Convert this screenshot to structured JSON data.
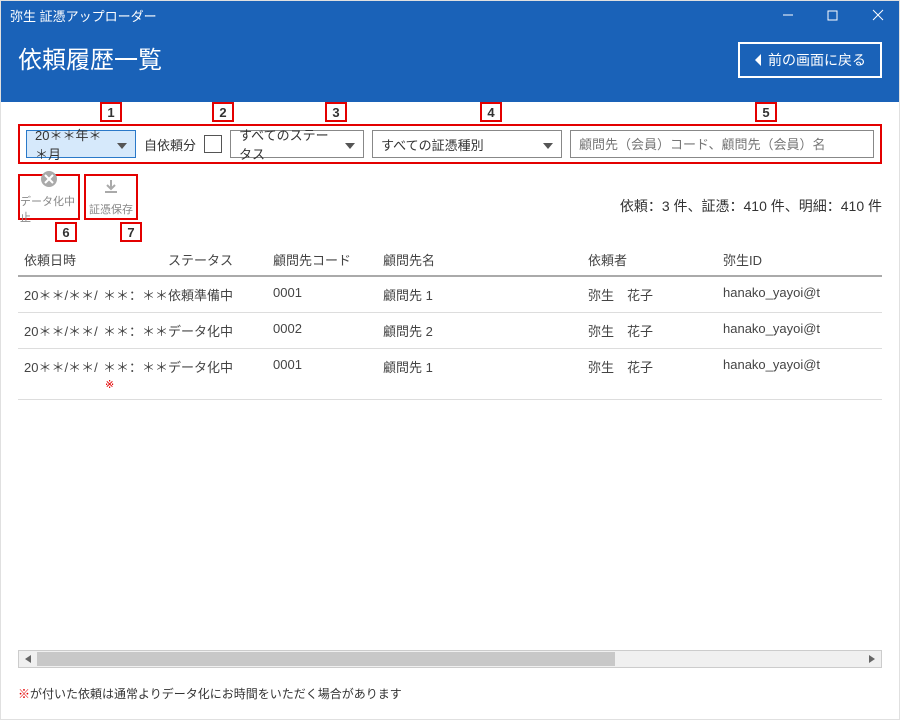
{
  "window": {
    "title": "弥生 証憑アップローダー"
  },
  "header": {
    "title": "依頼履歴一覧",
    "back_label": "前の画面に戻る"
  },
  "callouts": [
    "1",
    "2",
    "3",
    "4",
    "5",
    "6",
    "7"
  ],
  "filters": {
    "date": "20＊＊年＊＊月",
    "self_label": "自依頼分",
    "status": "すべてのステータス",
    "category": "すべての証憑種別",
    "search_placeholder": "顧問先（会員）コード、顧問先（会員）名"
  },
  "tools": {
    "cancel": "データ化中止",
    "save": "証憑保存"
  },
  "counts_text": "依頼：3 件、証憑：410 件、明細：410 件",
  "columns": {
    "datetime": "依頼日時",
    "status": "ステータス",
    "code": "顧問先コード",
    "client": "顧問先名",
    "requester": "依頼者",
    "yayoi_id": "弥生ID"
  },
  "rows": [
    {
      "date": "20＊＊/＊＊/",
      "time": "＊＊：＊＊",
      "mark": "",
      "status": "依頼準備中",
      "code": "0001",
      "client": "顧問先 1",
      "requester": "弥生　花子",
      "yayoi_id": "hanako_yayoi@t"
    },
    {
      "date": "20＊＊/＊＊/",
      "time": "＊＊：＊＊",
      "mark": "",
      "status": "データ化中",
      "code": "0002",
      "client": "顧問先 2",
      "requester": "弥生　花子",
      "yayoi_id": "hanako_yayoi@t"
    },
    {
      "date": "20＊＊/＊＊/",
      "time": "＊＊：＊＊",
      "mark": "※",
      "status": "データ化中",
      "code": "0001",
      "client": "顧問先 1",
      "requester": "弥生　花子",
      "yayoi_id": "hanako_yayoi@t"
    }
  ],
  "footnote": {
    "mark": "※",
    "text": "が付いた依頼は通常よりデータ化にお時間をいただく場合があります"
  }
}
